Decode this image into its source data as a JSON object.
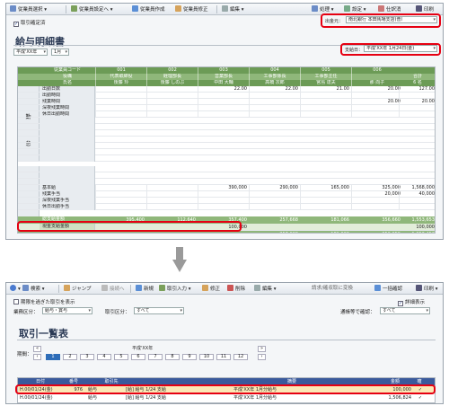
{
  "top": {
    "toolbar": {
      "select_employee": "従業員選択",
      "employee_setting": "従業員設定へ",
      "create_employee": "従業員作成",
      "edit_employee": "従業員修正",
      "edit_menu": "編集",
      "process": "処理",
      "settings": "設定",
      "journal_entry": "仕訳消",
      "print": "印刷"
    },
    "checkbox_label": "取引確定済",
    "source": "出金元：",
    "source_value": "南北銀行 本田馬場支店(普）",
    "title": "給与明細書",
    "era_select": "平成'XX年",
    "month_select": "1月",
    "payday_label": "支給日：",
    "payday_value": "平成'XX年 1月24日(金)",
    "header_rows": {
      "code": "従業員コード",
      "position": "役職",
      "name": "氏名"
    },
    "employees": [
      {
        "code": "001",
        "position": "代表取締役",
        "name": "後藤 玲"
      },
      {
        "code": "002",
        "position": "経理部長",
        "name": "後藤 しのぶ"
      },
      {
        "code": "003",
        "position": "営業部長",
        "name": "中田 大輔"
      },
      {
        "code": "004",
        "position": "工事部係長",
        "name": "高橋 次郎"
      },
      {
        "code": "005",
        "position": "工事部主任",
        "name": "宮島 達夫"
      },
      {
        "code": "006",
        "position": "",
        "name": "那 向子"
      }
    ],
    "total_label": "合計",
    "total_count": "6 名",
    "section_work": "勤\n怠",
    "work_rows": [
      {
        "label": "出勤日数",
        "values": [
          "",
          "",
          "22.00",
          "22.00",
          "21.00",
          "20.00"
        ],
        "total": "127.00"
      },
      {
        "label": "出勤時間",
        "values": [
          "",
          "",
          "",
          "",
          "",
          ""
        ],
        "total": ""
      },
      {
        "label": "残業時間",
        "values": [
          "",
          "",
          "",
          "",
          "",
          "20.00"
        ],
        "total": "20.00"
      },
      {
        "label": "深夜残業時間",
        "values": [
          "",
          "",
          "",
          "",
          "",
          ""
        ],
        "total": ""
      },
      {
        "label": "休日出勤時間",
        "values": [
          "",
          "",
          "",
          "",
          "",
          ""
        ],
        "total": ""
      }
    ],
    "pay_rows": [
      {
        "label": "基本給",
        "values": [
          "",
          "",
          "390,000",
          "290,000",
          "165,000",
          "325,000"
        ],
        "total": "1,568,000"
      },
      {
        "label": "残業手当",
        "values": [
          "",
          "",
          "",
          "",
          "",
          "20,000"
        ],
        "total": "40,000"
      },
      {
        "label": "深夜残業手当",
        "values": [
          "",
          "",
          "",
          "",
          "",
          ""
        ],
        "total": ""
      },
      {
        "label": "休日出勤手当",
        "values": [
          "",
          "",
          "",
          "",
          "",
          ""
        ],
        "total": ""
      }
    ],
    "total_pay_label": "総支給金額",
    "total_pay_values": [
      "395,400",
      "112,640",
      "357,400",
      "257,668",
      "181,066",
      "356,660"
    ],
    "total_pay_total": "1,553,653",
    "cash_label": "現金支給金額",
    "cash_values": [
      "",
      "",
      "100,000",
      "",
      "",
      ""
    ],
    "cash_total": "100,000",
    "bottom_values": [
      "",
      "",
      "",
      "257,668",
      "181,066",
      "356,659"
    ],
    "bottom_total": "1,353,453"
  },
  "bottom": {
    "toolbar": {
      "search": "検索",
      "jump": "ジャンプ",
      "connect": "接続へ",
      "new": "新規",
      "input": "取引入力",
      "edit": "修正",
      "delete": "削除",
      "edit_menu": "編集",
      "convert": "請求/確収取に変換",
      "bulk_confirm": "一括確認",
      "print": "印刷"
    },
    "period_check": "期限を過ぎた取引を表示",
    "detail_check": "詳細表示",
    "business_label": "業務区分：",
    "business_value": "給与・賞与",
    "trade_label": "取引区分：",
    "trade_value": "すべて",
    "confirm_label": "通帳等で確認：",
    "confirm_value": "すべて",
    "title": "取引一覧表",
    "period_label": "期間：",
    "year_label": "平成'XX年",
    "months": [
      "1",
      "2",
      "3",
      "4",
      "5",
      "6",
      "7",
      "8",
      "9",
      "10",
      "11",
      "12"
    ],
    "columns": [
      "日付",
      "番号",
      "取引先",
      "",
      "",
      "摘要",
      "",
      "",
      "金額",
      "確"
    ],
    "rows": [
      {
        "date": "H.00/01/24(金)",
        "no": "976",
        "partner": "給与",
        "desc": "[給] 給与  1/24 支給",
        "memo": "平成'XX年 1月分給与",
        "amount": "100,000",
        "check": "✓"
      },
      {
        "date": "H.00/01/24(金)",
        "no": "",
        "partner": "給与",
        "desc": "[給] 給与  1/24 支給",
        "memo": "平成'XX年 1月分給与",
        "amount": "1,506,824",
        "check": "✓"
      }
    ]
  },
  "colors": {
    "header_green": "#6c9b56",
    "accent_red": "#e60012",
    "header_blue": "#3a5a9c",
    "highlight": "#fbe8b6"
  }
}
